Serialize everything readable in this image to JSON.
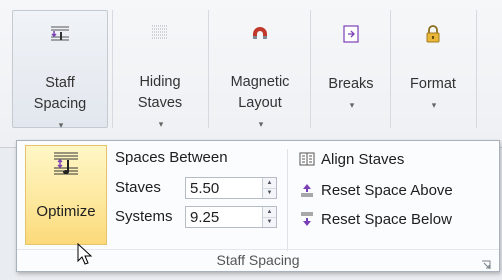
{
  "ribbon": {
    "buttons": [
      {
        "line1": "Staff",
        "line2": "Spacing",
        "caret": "▾",
        "icon": "staff-spacing-icon"
      },
      {
        "line1": "Hiding",
        "line2": "Staves",
        "caret": "▾",
        "icon": "hiding-staves-icon"
      },
      {
        "line1": "Magnetic",
        "line2": "Layout",
        "caret": "▾",
        "icon": "magnet-icon"
      },
      {
        "line1": "Breaks",
        "line2": "",
        "caret": "▾",
        "icon": "breaks-icon"
      },
      {
        "line1": "Format",
        "line2": "",
        "caret": "▾",
        "icon": "format-lock-icon"
      }
    ]
  },
  "popup": {
    "optimize_label": "Optimize",
    "spaces_between": "Spaces Between",
    "staves_label": "Staves",
    "staves_value": "5.50",
    "systems_label": "Systems",
    "systems_value": "9.25",
    "align_staves": "Align Staves",
    "reset_above": "Reset Space Above",
    "reset_below": "Reset Space Below",
    "group_title": "Staff Spacing"
  },
  "colors": {
    "optimize_bg": "#fde79b",
    "accent_red": "#c0392b",
    "accent_purple": "#7b3fb5"
  }
}
